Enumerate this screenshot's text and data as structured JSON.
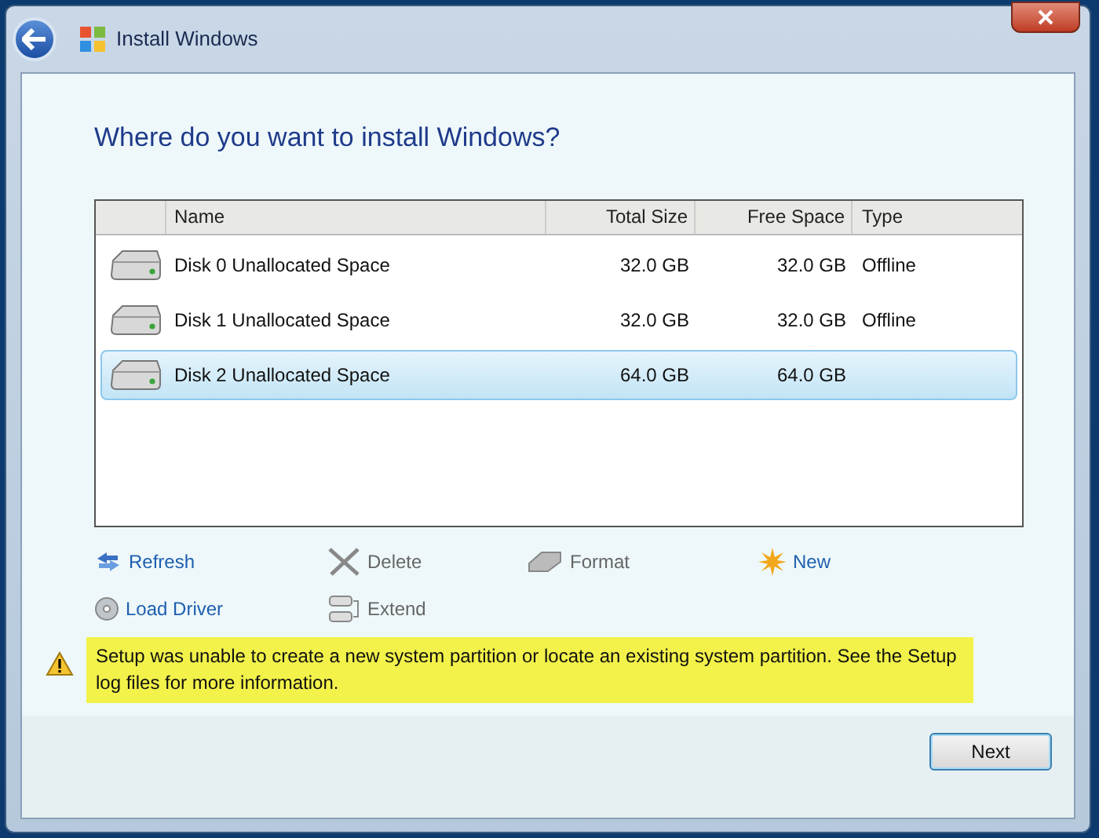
{
  "window": {
    "title": "Install Windows"
  },
  "heading": "Where do you want to install Windows?",
  "table": {
    "columns": [
      "Name",
      "Total Size",
      "Free Space",
      "Type"
    ],
    "rows": [
      {
        "name": "Disk 0 Unallocated Space",
        "total": "32.0 GB",
        "free": "32.0 GB",
        "type": "Offline",
        "selected": false
      },
      {
        "name": "Disk 1 Unallocated Space",
        "total": "32.0 GB",
        "free": "32.0 GB",
        "type": "Offline",
        "selected": false
      },
      {
        "name": "Disk 2 Unallocated Space",
        "total": "64.0 GB",
        "free": "64.0 GB",
        "selected": true
      }
    ]
  },
  "actions": [
    {
      "label": "Refresh",
      "kind": "refresh",
      "disabled": false
    },
    {
      "label": "Delete",
      "kind": "delete",
      "disabled": true
    },
    {
      "label": "Format",
      "kind": "format",
      "disabled": true
    },
    {
      "label": "New",
      "kind": "new",
      "disabled": false
    },
    {
      "label": "Load Driver",
      "kind": "load",
      "disabled": false
    },
    {
      "label": "Extend",
      "kind": "extend",
      "disabled": true
    }
  ],
  "warning": "Setup was unable to create a new system partition or locate an existing system partition. See the Setup log files for more information.",
  "buttons": [
    {
      "label": "Next"
    }
  ]
}
